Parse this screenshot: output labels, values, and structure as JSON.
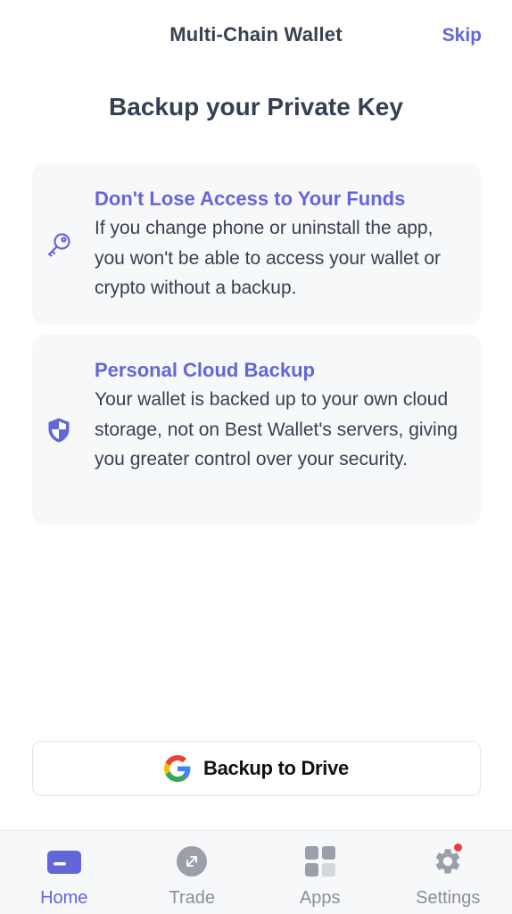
{
  "header": {
    "title": "Multi-Chain Wallet",
    "skip_label": "Skip"
  },
  "page_title": "Backup your Private Key",
  "cards": [
    {
      "icon": "key-icon",
      "heading": "Don't Lose Access to Your Funds",
      "text": "If you change phone or uninstall the app, you won't be able to access your wallet or crypto without a backup."
    },
    {
      "icon": "shield-icon",
      "heading": "Personal Cloud Backup",
      "text": "Your wallet is backed up to your own cloud storage, not on Best Wallet's servers, giving you greater control over your security."
    }
  ],
  "backup_button": {
    "icon": "google-icon",
    "label": "Backup to Drive"
  },
  "tabs": [
    {
      "label": "Home",
      "icon": "wallet-card-icon",
      "active": true
    },
    {
      "label": "Trade",
      "icon": "trade-arrows-icon",
      "active": false
    },
    {
      "label": "Apps",
      "icon": "apps-grid-icon",
      "active": false
    },
    {
      "label": "Settings",
      "icon": "gear-icon",
      "active": false,
      "badge": true
    }
  ],
  "colors": {
    "accent": "#6366d9",
    "text": "#374151",
    "card_bg": "#f7f8fa",
    "badge": "#ef3b3b"
  }
}
